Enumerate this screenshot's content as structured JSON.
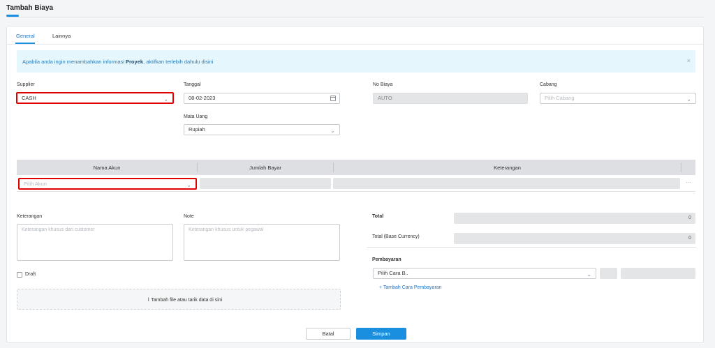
{
  "header": {
    "title": "Tambah Biaya"
  },
  "tabs": [
    {
      "label": "General"
    },
    {
      "label": "Lainnya"
    }
  ],
  "banner": {
    "text_before": "Apabila anda ingin menambahkan informasi ",
    "text_bold": "Proyek",
    "text_after": ", aktifkan terlebih dahulu ",
    "link": "disini",
    "close_icon": "×"
  },
  "form": {
    "supplier": {
      "label": "Supplier",
      "value": "CASH"
    },
    "tanggal": {
      "label": "Tanggal",
      "value": "08-02-2023"
    },
    "no_biaya": {
      "label": "No Biaya",
      "value": "AUTO"
    },
    "cabang": {
      "label": "Cabang",
      "placeholder": "Pilih Cabang"
    },
    "mata_uang": {
      "label": "Mata Uang",
      "value": "Rupiah"
    }
  },
  "table": {
    "columns": [
      "Nama Akun",
      "Jumlah Bayar",
      "Keterangan"
    ],
    "row": {
      "akun_placeholder": "Pilih Akun",
      "more": "···"
    }
  },
  "bottom": {
    "keterangan": {
      "label": "Keterangan",
      "placeholder": "Keterangan khusus dari customer"
    },
    "note": {
      "label": "Note",
      "placeholder": "Keterangan khusus untuk pegawai"
    },
    "draft_label": "Draft",
    "upload_text": "Tambah file atau tarik data di sini"
  },
  "totals": {
    "total_label": "Total",
    "total_value": "0",
    "base_label": "Total (Base Currency)",
    "base_value": "0"
  },
  "payment": {
    "label": "Pembayaran",
    "method_placeholder": "Pilih Cara B..",
    "add_label": "Tambah Cara Pembayaran"
  },
  "actions": {
    "cancel": "Batal",
    "save": "Simpan"
  },
  "colors": {
    "accent": "#1a8fe0",
    "highlight": "#e00000",
    "banner_bg": "#e6f6fd"
  }
}
